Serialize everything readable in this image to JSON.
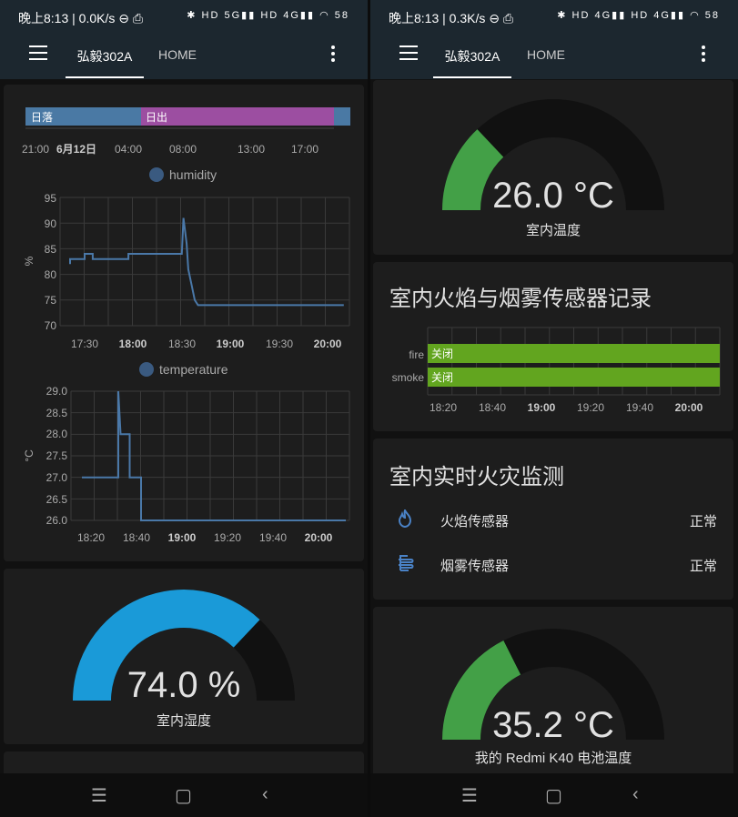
{
  "status_left": {
    "time": "晚上8:13 | 0.0K/s ⊖ ⎙",
    "icons": "✱ HD 5G▮▮ HD 4G▮▮ ◠ 58"
  },
  "status_right": {
    "time": "晚上8:13 | 0.3K/s ⊖ ⎙",
    "icons": "✱ HD 4G▮▮ HD 4G▮▮ ◠ 58"
  },
  "tabs": {
    "room": "弘毅302A",
    "home": "HOME"
  },
  "colors": {
    "accent_blue": "#1a9ad8",
    "gauge_green": "#43a047",
    "bar_green": "#62a51f",
    "line_blue": "#4a78a8",
    "sunset_bar": "#4a79a4",
    "sunrise_bar": "#9c4ea1"
  },
  "timeline": {
    "segments": [
      {
        "label": "日落"
      },
      {
        "label": "日出"
      }
    ],
    "ticks": [
      "21:00",
      "6月12日",
      "04:00",
      "08:00",
      "13:00",
      "17:00"
    ]
  },
  "humidity_chart": {
    "legend": "humidity",
    "ylabel": "%",
    "yticks": [
      "95",
      "90",
      "85",
      "80",
      "75",
      "70"
    ],
    "xticks": [
      "17:30",
      "18:00",
      "18:30",
      "19:00",
      "19:30",
      "20:00"
    ]
  },
  "temperature_chart": {
    "legend": "temperature",
    "ylabel": "°C",
    "yticks": [
      "29.0",
      "28.5",
      "28.0",
      "27.5",
      "27.0",
      "26.5",
      "26.0"
    ],
    "xticks": [
      "18:20",
      "18:40",
      "19:00",
      "19:20",
      "19:40",
      "20:00"
    ]
  },
  "humidity_gauge": {
    "value": 74.0,
    "value_text": "74.0 %",
    "label": "室内湿度"
  },
  "temp_gauge": {
    "value": 26.0,
    "value_text": "26.0 °C",
    "label": "室内温度"
  },
  "battery_gauge": {
    "value": 35.2,
    "value_text": "35.2 °C",
    "label": "我的 Redmi K40 电池温度"
  },
  "fire_smoke_log": {
    "title": "室内火焰与烟雾传感器记录",
    "rows": [
      {
        "name": "fire",
        "state": "关闭"
      },
      {
        "name": "smoke",
        "state": "关闭"
      }
    ],
    "xticks": [
      "18:20",
      "18:40",
      "19:00",
      "19:20",
      "19:40",
      "20:00"
    ]
  },
  "fire_monitor": {
    "title": "室内实时火灾监测",
    "sensors": [
      {
        "label": "火焰传感器",
        "state": "正常",
        "icon": "flame-icon"
      },
      {
        "label": "烟雾传感器",
        "state": "正常",
        "icon": "smoke-icon"
      }
    ]
  },
  "navbar": {
    "recents": "☰",
    "home": "▢",
    "back": "‹"
  },
  "chart_data": [
    {
      "type": "line",
      "title": "",
      "legend": [
        "humidity"
      ],
      "ylabel": "%",
      "ylim": [
        70,
        95
      ],
      "series": [
        {
          "name": "humidity",
          "points": [
            [
              "17:21",
              82
            ],
            [
              "17:21",
              83
            ],
            [
              "17:30",
              83
            ],
            [
              "17:30",
              84
            ],
            [
              "17:35",
              84
            ],
            [
              "17:35",
              83
            ],
            [
              "17:57",
              83
            ],
            [
              "17:57",
              84
            ],
            [
              "18:30",
              84
            ],
            [
              "18:31",
              91
            ],
            [
              "18:33",
              86
            ],
            [
              "18:34",
              81
            ],
            [
              "18:36",
              78
            ],
            [
              "18:38",
              75
            ],
            [
              "18:40",
              74
            ],
            [
              "20:10",
              74
            ]
          ]
        }
      ]
    },
    {
      "type": "line",
      "title": "",
      "legend": [
        "temperature"
      ],
      "ylabel": "°C",
      "ylim": [
        26.0,
        29.0
      ],
      "series": [
        {
          "name": "temperature",
          "points": [
            [
              "18:16",
              27.0
            ],
            [
              "18:32",
              27.0
            ],
            [
              "18:32",
              29.0
            ],
            [
              "18:33",
              28.0
            ],
            [
              "18:37",
              28.0
            ],
            [
              "18:37",
              27.0
            ],
            [
              "18:42",
              27.0
            ],
            [
              "18:42",
              26.0
            ],
            [
              "20:12",
              26.0
            ]
          ]
        }
      ]
    },
    {
      "type": "bar",
      "title": "室内火焰与烟雾传感器记录",
      "categories": [
        "fire",
        "smoke"
      ],
      "series": [
        {
          "name": "state",
          "values": [
            "关闭",
            "关闭"
          ]
        }
      ]
    }
  ]
}
